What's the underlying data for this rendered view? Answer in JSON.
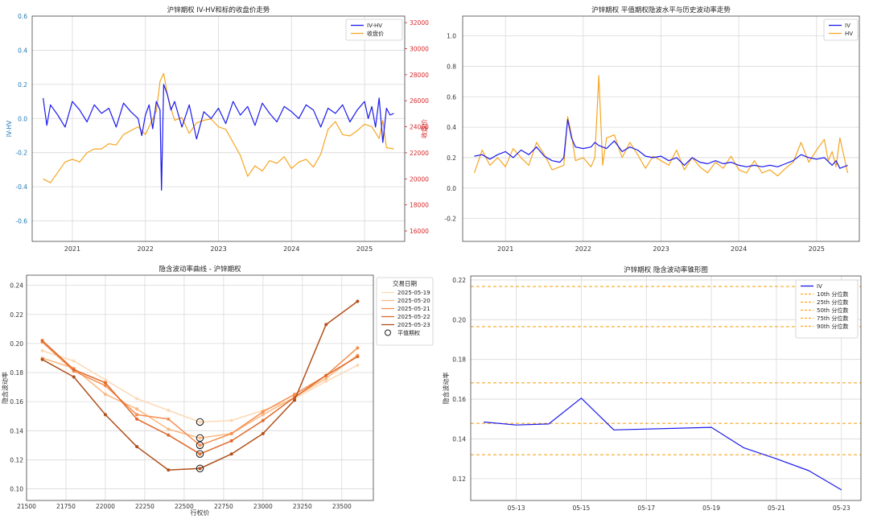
{
  "colors": {
    "iv_blue": "#1a1aee",
    "orange": "#f5a623",
    "red_axis": "#d62728",
    "blue_axis": "#1f77b4",
    "grid": "#d9d9d9"
  },
  "chart_data": [
    {
      "id": "iv_hv_price",
      "type": "line",
      "title": "沪锌期权 IV-HV和标的收盘价走势",
      "ylabel": "IV-HV",
      "y2label": "收盘价",
      "ylim": [
        -0.72,
        0.6
      ],
      "y2lim": [
        15200,
        32500
      ],
      "xlim": [
        2020.45,
        2025.55
      ],
      "xticks": [
        "2021",
        "2022",
        "2023",
        "2024",
        "2025"
      ],
      "yticks": [
        "0.6",
        "0.4",
        "0.2",
        "0.0",
        "-0.2",
        "-0.4",
        "-0.6"
      ],
      "y2ticks": [
        "32000",
        "30000",
        "28000",
        "26000",
        "24000",
        "22000",
        "20000",
        "18000",
        "16000"
      ],
      "legend": [
        "IV-HV",
        "收盘价"
      ],
      "series": [
        {
          "name": "IV-HV",
          "x": [
            2020.6,
            2020.65,
            2020.7,
            2020.8,
            2020.9,
            2021.0,
            2021.1,
            2021.2,
            2021.3,
            2021.4,
            2021.5,
            2021.6,
            2021.7,
            2021.8,
            2021.9,
            2021.95,
            2022.0,
            2022.05,
            2022.1,
            2022.15,
            2022.2,
            2022.22,
            2022.25,
            2022.3,
            2022.35,
            2022.4,
            2022.5,
            2022.6,
            2022.7,
            2022.8,
            2022.9,
            2023.0,
            2023.1,
            2023.2,
            2023.3,
            2023.4,
            2023.5,
            2023.6,
            2023.7,
            2023.8,
            2023.9,
            2024.0,
            2024.1,
            2024.2,
            2024.3,
            2024.4,
            2024.5,
            2024.6,
            2024.7,
            2024.8,
            2024.9,
            2025.0,
            2025.05,
            2025.1,
            2025.15,
            2025.2,
            2025.25,
            2025.3,
            2025.35,
            2025.4
          ],
          "y": [
            0.12,
            -0.04,
            0.08,
            0.02,
            -0.05,
            0.1,
            0.05,
            -0.02,
            0.08,
            0.03,
            0.06,
            -0.05,
            0.09,
            0.04,
            0.0,
            -0.1,
            0.02,
            0.08,
            -0.06,
            0.1,
            0.05,
            -0.42,
            0.2,
            0.14,
            0.05,
            0.1,
            -0.05,
            0.08,
            -0.12,
            0.04,
            0.0,
            0.06,
            -0.03,
            0.1,
            0.02,
            0.07,
            -0.04,
            0.09,
            0.03,
            -0.02,
            0.07,
            0.04,
            0.0,
            0.08,
            0.05,
            -0.05,
            0.06,
            0.03,
            0.08,
            -0.02,
            0.05,
            0.1,
            0.0,
            0.07,
            -0.05,
            0.12,
            -0.14,
            0.06,
            0.02,
            0.03
          ]
        },
        {
          "name": "收盘价",
          "x": [
            2020.6,
            2020.7,
            2020.8,
            2020.9,
            2021.0,
            2021.1,
            2021.2,
            2021.3,
            2021.4,
            2021.5,
            2021.6,
            2021.7,
            2021.8,
            2021.9,
            2022.0,
            2022.1,
            2022.15,
            2022.2,
            2022.25,
            2022.3,
            2022.35,
            2022.4,
            2022.5,
            2022.6,
            2022.7,
            2022.8,
            2022.9,
            2023.0,
            2023.1,
            2023.2,
            2023.3,
            2023.4,
            2023.5,
            2023.6,
            2023.7,
            2023.8,
            2023.9,
            2024.0,
            2024.1,
            2024.2,
            2024.3,
            2024.4,
            2024.5,
            2024.6,
            2024.7,
            2024.8,
            2024.9,
            2025.0,
            2025.1,
            2025.2,
            2025.25,
            2025.3,
            2025.4
          ],
          "y": [
            20000,
            19700,
            20500,
            21300,
            21500,
            21300,
            22000,
            22300,
            22300,
            22700,
            22600,
            23400,
            23700,
            24000,
            23400,
            24600,
            25200,
            27500,
            28100,
            26500,
            25400,
            24500,
            24700,
            23500,
            24300,
            24500,
            24600,
            24000,
            23800,
            22800,
            21800,
            20200,
            21000,
            20600,
            21400,
            21200,
            21700,
            20800,
            21300,
            21500,
            20900,
            21900,
            23800,
            24400,
            23400,
            23300,
            23700,
            24200,
            24000,
            23100,
            24500,
            22400,
            22300
          ]
        }
      ]
    },
    {
      "id": "atm_iv_hv",
      "type": "line",
      "title": "沪锌期权 平值期权隐波水平与历史波动率走势",
      "ylim": [
        -0.35,
        1.13
      ],
      "xlim": [
        2020.45,
        2025.55
      ],
      "xticks": [
        "2021",
        "2022",
        "2023",
        "2024",
        "2025"
      ],
      "yticks": [
        "1.0",
        "0.8",
        "0.6",
        "0.4",
        "0.2",
        "0.0",
        "-0.2"
      ],
      "legend": [
        "IV",
        "HV"
      ],
      "series": [
        {
          "name": "IV",
          "x": [
            2020.6,
            2020.7,
            2020.8,
            2020.9,
            2021.0,
            2021.1,
            2021.2,
            2021.3,
            2021.4,
            2021.5,
            2021.6,
            2021.7,
            2021.75,
            2021.8,
            2021.85,
            2021.9,
            2022.0,
            2022.1,
            2022.15,
            2022.2,
            2022.3,
            2022.4,
            2022.5,
            2022.6,
            2022.7,
            2022.8,
            2022.9,
            2023.0,
            2023.1,
            2023.2,
            2023.3,
            2023.4,
            2023.5,
            2023.6,
            2023.7,
            2023.8,
            2023.9,
            2024.0,
            2024.1,
            2024.2,
            2024.3,
            2024.4,
            2024.5,
            2024.6,
            2024.7,
            2024.8,
            2024.9,
            2025.0,
            2025.1,
            2025.2,
            2025.25,
            2025.3,
            2025.4
          ],
          "y": [
            0.21,
            0.22,
            0.19,
            0.22,
            0.24,
            0.2,
            0.25,
            0.22,
            0.27,
            0.21,
            0.18,
            0.17,
            0.2,
            0.45,
            0.33,
            0.27,
            0.26,
            0.27,
            0.3,
            0.28,
            0.26,
            0.31,
            0.24,
            0.27,
            0.25,
            0.21,
            0.2,
            0.21,
            0.18,
            0.2,
            0.15,
            0.2,
            0.17,
            0.16,
            0.18,
            0.16,
            0.17,
            0.15,
            0.14,
            0.15,
            0.14,
            0.15,
            0.14,
            0.16,
            0.18,
            0.22,
            0.2,
            0.19,
            0.2,
            0.15,
            0.18,
            0.13,
            0.15
          ]
        },
        {
          "name": "HV",
          "x": [
            2020.6,
            2020.7,
            2020.8,
            2020.9,
            2021.0,
            2021.1,
            2021.2,
            2021.3,
            2021.4,
            2021.5,
            2021.6,
            2021.7,
            2021.75,
            2021.8,
            2021.85,
            2021.9,
            2022.0,
            2022.1,
            2022.15,
            2022.2,
            2022.25,
            2022.3,
            2022.4,
            2022.5,
            2022.6,
            2022.7,
            2022.8,
            2022.9,
            2023.0,
            2023.1,
            2023.2,
            2023.3,
            2023.4,
            2023.5,
            2023.6,
            2023.7,
            2023.8,
            2023.9,
            2024.0,
            2024.1,
            2024.2,
            2024.3,
            2024.4,
            2024.5,
            2024.6,
            2024.7,
            2024.8,
            2024.9,
            2025.0,
            2025.1,
            2025.15,
            2025.2,
            2025.25,
            2025.3,
            2025.4
          ],
          "y": [
            0.1,
            0.25,
            0.15,
            0.2,
            0.14,
            0.26,
            0.2,
            0.15,
            0.3,
            0.22,
            0.12,
            0.14,
            0.15,
            0.47,
            0.35,
            0.18,
            0.2,
            0.14,
            0.2,
            0.74,
            0.15,
            0.33,
            0.35,
            0.2,
            0.3,
            0.22,
            0.13,
            0.21,
            0.18,
            0.15,
            0.25,
            0.12,
            0.2,
            0.14,
            0.1,
            0.17,
            0.13,
            0.21,
            0.12,
            0.1,
            0.18,
            0.1,
            0.12,
            0.08,
            0.13,
            0.17,
            0.3,
            0.17,
            0.25,
            0.32,
            0.18,
            0.24,
            0.14,
            0.33,
            0.1
          ]
        }
      ]
    },
    {
      "id": "smile",
      "type": "line",
      "title": "隐含波动率曲线 - 沪锌期权",
      "xlabel": "行权价",
      "ylabel": "隐含波动率",
      "xlim": [
        21500,
        23700
      ],
      "ylim": [
        0.092,
        0.247
      ],
      "xticks": [
        21500,
        21750,
        22000,
        22250,
        22500,
        22750,
        23000,
        23250,
        23500
      ],
      "yticks": [
        "0.24",
        "0.22",
        "0.20",
        "0.18",
        "0.16",
        "0.14",
        "0.12",
        "0.10"
      ],
      "legend_title": "交易日期",
      "legend_marker_label": "平值期权",
      "atm_strike": 22600,
      "series": [
        {
          "name": "2025-05-19",
          "color": "#fdd9b5",
          "x": [
            21600,
            21800,
            22000,
            22200,
            22400,
            22600,
            22800,
            23000,
            23200,
            23400,
            23600
          ],
          "y": [
            0.195,
            0.188,
            0.175,
            0.162,
            0.154,
            0.146,
            0.147,
            0.154,
            0.162,
            0.174,
            0.185
          ]
        },
        {
          "name": "2025-05-20",
          "color": "#fbb982",
          "x": [
            21600,
            21800,
            22000,
            22200,
            22400,
            22600,
            22800,
            23000,
            23200,
            23400,
            23600
          ],
          "y": [
            0.19,
            0.183,
            0.165,
            0.155,
            0.141,
            0.135,
            0.138,
            0.151,
            0.163,
            0.176,
            0.192
          ]
        },
        {
          "name": "2025-05-21",
          "color": "#f58d4e",
          "x": [
            21600,
            21800,
            22000,
            22200,
            22400,
            22600,
            22800,
            23000,
            23200,
            23400,
            23600
          ],
          "y": [
            0.201,
            0.181,
            0.171,
            0.151,
            0.148,
            0.13,
            0.138,
            0.153,
            0.165,
            0.178,
            0.197
          ]
        },
        {
          "name": "2025-05-22",
          "color": "#df6a2c",
          "x": [
            21600,
            21800,
            22000,
            22200,
            22400,
            22600,
            22800,
            23000,
            23200,
            23400,
            23600
          ],
          "y": [
            0.202,
            0.182,
            0.173,
            0.148,
            0.137,
            0.124,
            0.133,
            0.147,
            0.163,
            0.178,
            0.191
          ]
        },
        {
          "name": "2025-05-23",
          "color": "#b0501c",
          "x": [
            21600,
            21800,
            22000,
            22200,
            22400,
            22600,
            22800,
            23000,
            23200,
            23400,
            23600
          ],
          "y": [
            0.189,
            0.177,
            0.151,
            0.129,
            0.113,
            0.114,
            0.124,
            0.138,
            0.161,
            0.213,
            0.229
          ]
        }
      ],
      "atm_points": [
        0.146,
        0.135,
        0.13,
        0.124,
        0.114
      ]
    },
    {
      "id": "cone",
      "type": "line",
      "title": "沪锌期权 隐含波动率锥形图",
      "ylabel": "隐含波动率",
      "xlim": [
        11.6,
        23.6
      ],
      "ylim": [
        0.109,
        0.222
      ],
      "xticks": [
        "05-13",
        "05-15",
        "05-17",
        "05-19",
        "05-21",
        "05-23"
      ],
      "xtick_days": [
        13,
        15,
        17,
        19,
        21,
        23
      ],
      "yticks": [
        "0.22",
        "0.20",
        "0.18",
        "0.16",
        "0.14",
        "0.12"
      ],
      "series": [
        {
          "name": "IV",
          "x": [
            12,
            13,
            14,
            15,
            16,
            19,
            20,
            21,
            22,
            23
          ],
          "y": [
            0.1485,
            0.147,
            0.1475,
            0.1605,
            0.1445,
            0.1458,
            0.1355,
            0.13,
            0.124,
            0.1143
          ]
        }
      ],
      "percentiles": [
        {
          "name": "10th 分位数",
          "value": 0.132
        },
        {
          "name": "25th 分位数",
          "value": 0.1478
        },
        {
          "name": "50th 分位数",
          "value": 0.1682
        },
        {
          "name": "75th 分位数",
          "value": 0.1965
        },
        {
          "name": "90th 分位数",
          "value": 0.2167
        }
      ]
    }
  ]
}
